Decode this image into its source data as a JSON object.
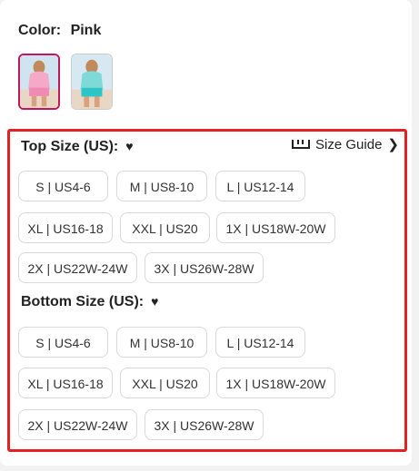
{
  "color": {
    "label": "Color:",
    "value": "Pink"
  },
  "top": {
    "title": "Top Size (US):",
    "guide_label": "Size Guide",
    "options": [
      "S | US4-6",
      "M | US8-10",
      "L | US12-14",
      "XL | US16-18",
      "XXL | US20",
      "1X | US18W-20W",
      "2X | US22W-24W",
      "3X | US26W-28W"
    ]
  },
  "bottom": {
    "title": "Bottom Size (US):",
    "options": [
      "S | US4-6",
      "M | US8-10",
      "L | US12-14",
      "XL | US16-18",
      "XXL | US20",
      "1X | US18W-20W",
      "2X | US22W-24W",
      "3X | US26W-28W"
    ]
  },
  "colors": {
    "highlight": "#e52020",
    "selected_swatch": "#c2185b"
  },
  "icons": {
    "heart": "heart-icon",
    "ruler": "ruler-icon",
    "chevron": "chevron-right-icon"
  }
}
